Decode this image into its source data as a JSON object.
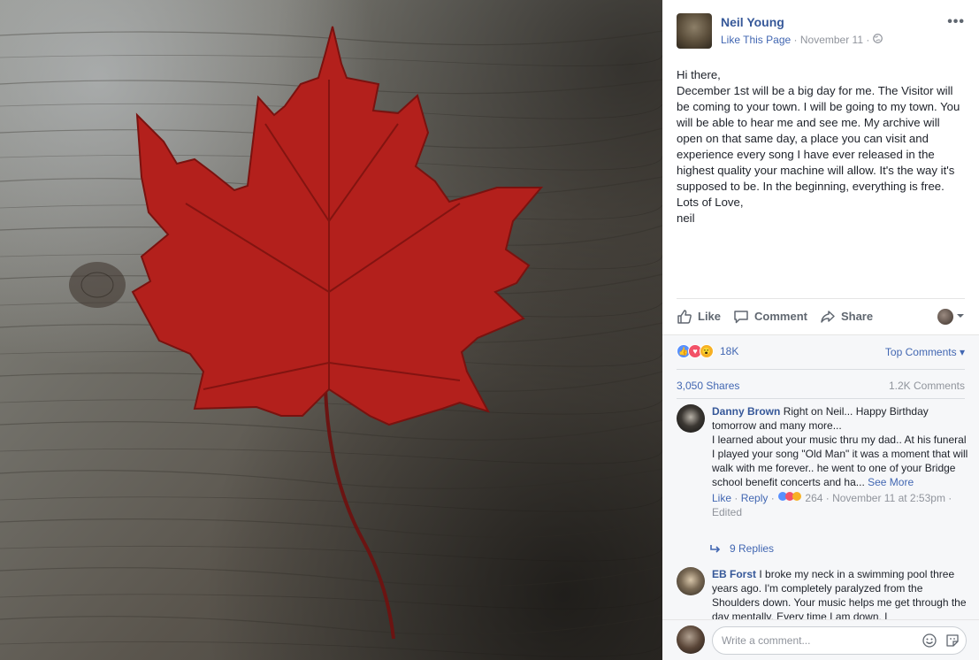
{
  "post": {
    "page_name": "Neil Young",
    "like_page_label": "Like This Page",
    "date": "November 11",
    "separator": "·",
    "text_lines": [
      "Hi there,",
      "December 1st will be a big day for me. The Visitor will be coming to your town. I will be going to my town. You will be able to hear me and see me. My archive will open on that same day, a place you can visit and experience every song I have ever released in the highest quality your machine will allow. It's the way it's supposed to be. In the beginning, everything is free.",
      "Lots of Love,",
      "neil"
    ]
  },
  "actions": {
    "like": "Like",
    "comment": "Comment",
    "share": "Share"
  },
  "feedback": {
    "reaction_count": "18K",
    "top_comments_label": "Top Comments",
    "shares": "3,050 Shares",
    "comments": "1.2K Comments"
  },
  "comments": [
    {
      "author": "Danny Brown",
      "text": "Right on Neil... Happy Birthday tomorrow and many more...",
      "text2": "I learned about your music thru my dad.. At his funeral I played your song \"Old Man\" it was a moment that will walk with me forever.. he went to one of your Bridge school benefit concerts and ha...",
      "see_more": "See More",
      "like": "Like",
      "reply": "Reply",
      "reaction_count": "264",
      "time": "November 11 at 2:53pm",
      "edited": "Edited",
      "replies": "9 Replies"
    },
    {
      "author": "EB Forst",
      "text": "I broke my neck in a swimming pool three years ago. I'm completely paralyzed from the Shoulders down. Your music helps me get through the day mentally. Every time I am down, I"
    }
  ],
  "composer": {
    "placeholder": "Write a comment..."
  },
  "colors": {
    "link": "#365899",
    "accent": "#4267b2",
    "leaf": "#b3201c"
  }
}
